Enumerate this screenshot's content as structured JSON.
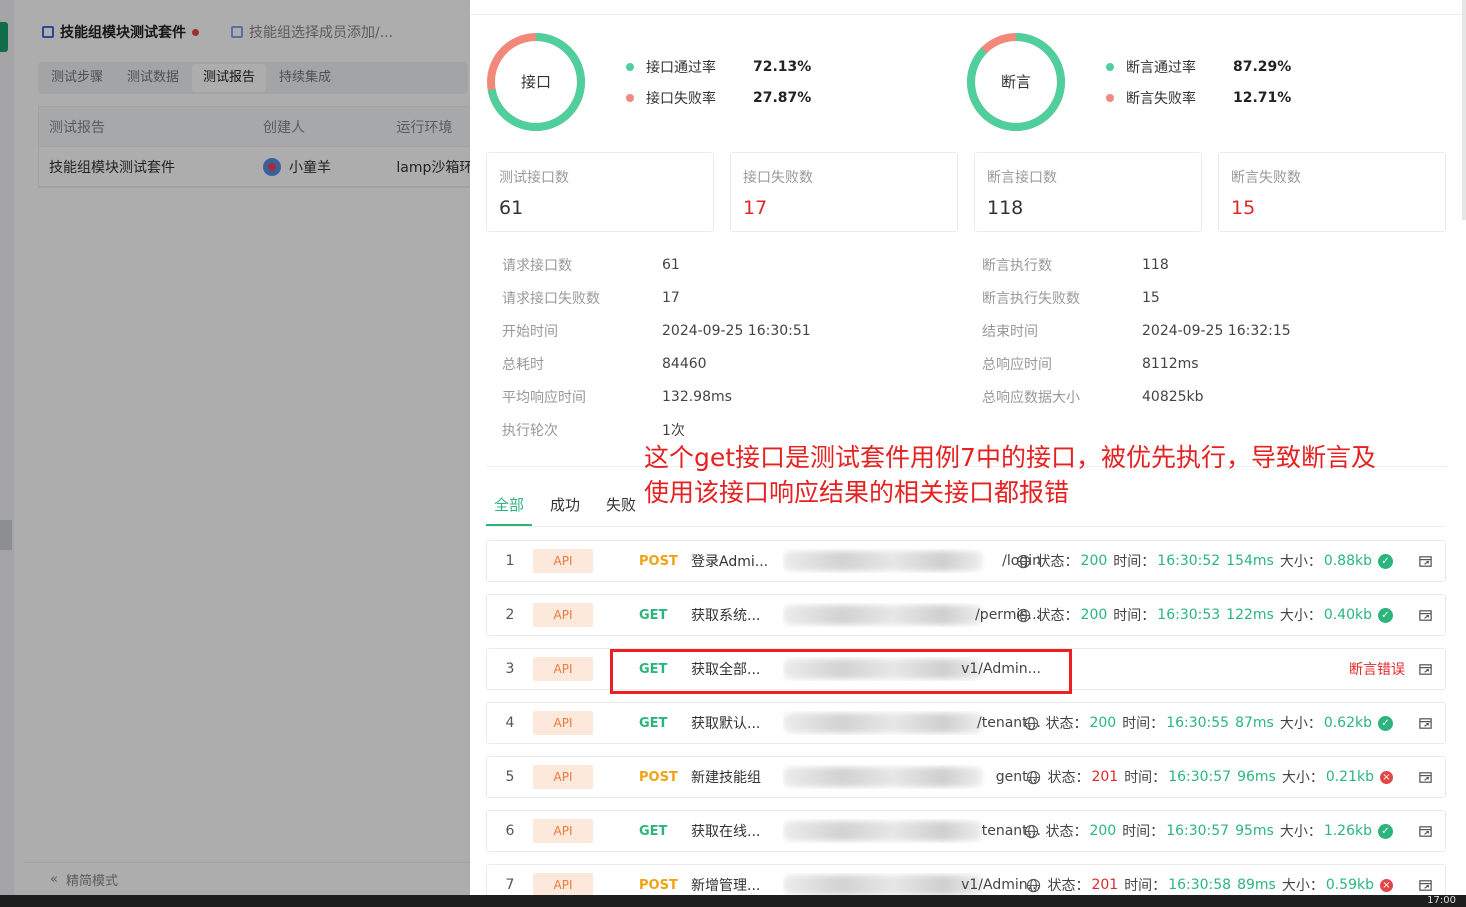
{
  "background": {
    "doc_tabs": [
      {
        "label": "技能组模块测试套件",
        "active": true,
        "unsaved": true
      },
      {
        "label": "技能组选择成员添加/...",
        "active": false,
        "unsaved": false
      }
    ],
    "sub_tabs": [
      "测试步骤",
      "测试数据",
      "测试报告",
      "持续集成"
    ],
    "active_sub_tab": "测试报告",
    "table": {
      "headers": [
        "测试报告",
        "创建人",
        "运行环境"
      ],
      "rows": [
        [
          "技能组模块测试套件",
          "小童羊",
          "lamp沙箱环"
        ]
      ]
    },
    "compact_mode_label": "精简模式"
  },
  "summary": {
    "interface": {
      "label": "接口",
      "pass_label": "接口通过率",
      "pass_rate": "72.13%",
      "fail_label": "接口失败率",
      "fail_rate": "27.87%",
      "pass_fraction": 0.7213
    },
    "assertion": {
      "label": "断言",
      "pass_label": "断言通过率",
      "pass_rate": "87.29%",
      "fail_label": "断言失败率",
      "fail_rate": "12.71%",
      "pass_fraction": 0.8729
    },
    "colors": {
      "pass": "#4fcf9b",
      "fail": "#f0897a"
    }
  },
  "stat_cards": [
    {
      "title": "测试接口数",
      "value": "61",
      "danger": false
    },
    {
      "title": "接口失败数",
      "value": "17",
      "danger": true
    },
    {
      "title": "断言接口数",
      "value": "118",
      "danger": false
    },
    {
      "title": "断言失败数",
      "value": "15",
      "danger": true
    }
  ],
  "details_left": [
    {
      "k": "请求接口数",
      "v": "61"
    },
    {
      "k": "请求接口失败数",
      "v": "17"
    },
    {
      "k": "开始时间",
      "v": "2024-09-25 16:30:51"
    },
    {
      "k": "总耗时",
      "v": "84460"
    },
    {
      "k": "平均响应时间",
      "v": "132.98ms"
    },
    {
      "k": "执行轮次",
      "v": "1次"
    }
  ],
  "details_right": [
    {
      "k": "断言执行数",
      "v": "118"
    },
    {
      "k": "断言执行失败数",
      "v": "15"
    },
    {
      "k": "结束时间",
      "v": "2024-09-25 16:32:15"
    },
    {
      "k": "总响应时间",
      "v": "8112ms"
    },
    {
      "k": "总响应数据大小",
      "v": "40825kb"
    }
  ],
  "filter_tabs": [
    "全部",
    "成功",
    "失败"
  ],
  "active_filter": "全部",
  "annotation": [
    "这个get接口是测试套件用例7中的接口，被优先执行，导致断言及",
    "使用该接口响应结果的相关接口都报错"
  ],
  "labels": {
    "api": "API",
    "status": "状态：",
    "time": "时间：",
    "size": "大小：",
    "assert_error": "断言错误"
  },
  "requests": [
    {
      "idx": "1",
      "method": "POST",
      "name": "登录Admi...",
      "url_tail": "/login",
      "status": "200",
      "time": "16:30:52",
      "duration": "154ms",
      "size": "0.88kb",
      "ok": true
    },
    {
      "idx": "2",
      "method": "GET",
      "name": "获取系统...",
      "url_tail": "/permis...",
      "status": "200",
      "time": "16:30:53",
      "duration": "122ms",
      "size": "0.40kb",
      "ok": true
    },
    {
      "idx": "3",
      "method": "GET",
      "name": "获取全部...",
      "url_tail": "v1/Admin...",
      "assert_error": true
    },
    {
      "idx": "4",
      "method": "GET",
      "name": "获取默认...",
      "url_tail": "/tenant...",
      "status": "200",
      "time": "16:30:55",
      "duration": "87ms",
      "size": "0.62kb",
      "ok": true
    },
    {
      "idx": "5",
      "method": "POST",
      "name": "新建技能组",
      "url_tail": "gent...",
      "status": "201",
      "time": "16:30:57",
      "duration": "96ms",
      "size": "0.21kb",
      "ok": false
    },
    {
      "idx": "6",
      "method": "GET",
      "name": "获取在线...",
      "url_tail": "tenant...",
      "status": "200",
      "time": "16:30:57",
      "duration": "95ms",
      "size": "1.26kb",
      "ok": true
    },
    {
      "idx": "7",
      "method": "POST",
      "name": "新增管理...",
      "url_tail": "v1/Admin...",
      "status": "201",
      "time": "16:30:58",
      "duration": "89ms",
      "size": "0.59kb",
      "ok": false
    }
  ],
  "taskbar_time": "17:00"
}
